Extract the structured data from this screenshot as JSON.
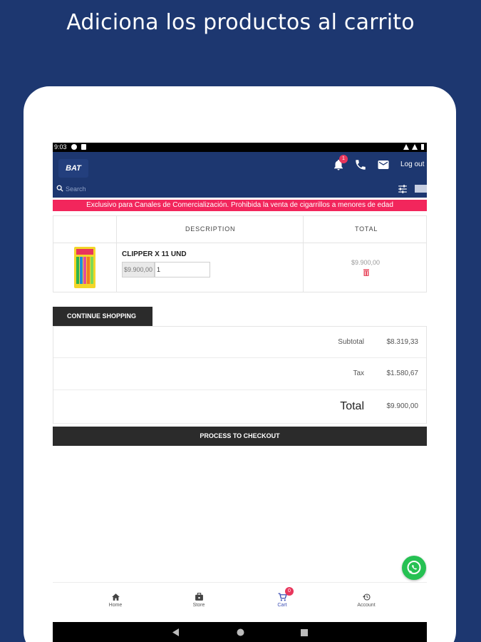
{
  "promo": {
    "title": "Adiciona los productos al carrito"
  },
  "status_bar": {
    "time": "9:03"
  },
  "header": {
    "logo_text": "BAT",
    "notification_count": "1",
    "logout_label": "Log out",
    "search_placeholder": "Search"
  },
  "banner": {
    "text": "Exclusivo para Canales de Comercialización. Prohibida la venta de cigarrillos a menores de edad"
  },
  "cart": {
    "columns": [
      "",
      "DESCRIPTION",
      "TOTAL"
    ],
    "items": [
      {
        "name": "CLIPPER X 11 UND",
        "unit_price": "$9.900,00",
        "quantity": "1",
        "total": "$9.900,00"
      }
    ]
  },
  "actions": {
    "continue_label": "CONTINUE SHOPPING",
    "checkout_label": "PROCESS TO CHECKOUT"
  },
  "summary": {
    "subtotal_label": "Subtotal",
    "subtotal": "$8.319,33",
    "tax_label": "Tax",
    "tax": "$1.580,67",
    "total_label": "Total",
    "total": "$9.900,00"
  },
  "bottom_nav": {
    "home": "Home",
    "store": "Store",
    "cart": "Cart",
    "cart_count": "0",
    "account": "Account"
  },
  "colors": {
    "background": "#1d3770",
    "banner": "#f2265c",
    "button_dark": "#2b2b2b",
    "whatsapp": "#26c153",
    "nav_active": "#3f51b5"
  }
}
